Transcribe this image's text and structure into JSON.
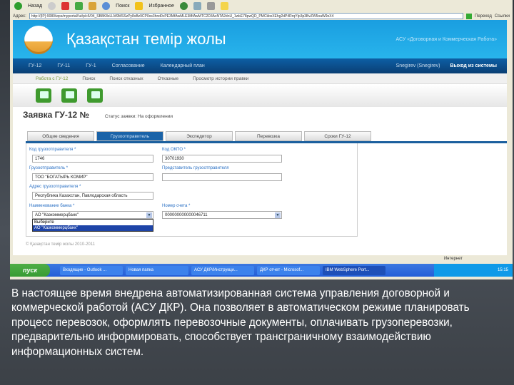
{
  "browser": {
    "back": "Назад",
    "search": "Поиск",
    "favorites": "Избранное",
    "address_label": "Адрес:",
    "url": "http://{IP}:9080/wps/myportal/!ut/p/c5/04_SB8K8xLLM9MSSzPy8xBz9CP0os3hnd0cPE3MfAwMLE3MfAwMTC2D3AxNTA2dnU_1wkE78pwQD_PMCkbxXEhg2dP4RrqYIp3p3BvZW5oaW9oX4",
    "go": "Переход",
    "links": "Ссылки"
  },
  "header": {
    "brand": "Қазақстан темір жолы",
    "subtitle": "АСУ «Договорная и Коммерческая Работа»"
  },
  "nav": {
    "items": [
      "ГУ-12",
      "ГУ-11",
      "ГУ-1",
      "Согласование",
      "Календарный план"
    ],
    "user": "Snegirev (Snegirev)",
    "logout": "Выход из системы"
  },
  "subnav": {
    "items": [
      "Работа с ГУ-12",
      "Поиск",
      "Поиск отказных",
      "Отказные",
      "Просмотр истории правки"
    ]
  },
  "page": {
    "title": "Заявка ГУ-12 №",
    "status": "Статус заявки: На оформлении"
  },
  "tabs": [
    "Общие сведения",
    "Грузоотправитель",
    "Экспедитор",
    "Перевозка",
    "Сроки ГУ-12"
  ],
  "form": {
    "shipper_code_label": "Код грузоотправителя *",
    "shipper_code": "1746",
    "okpo_label": "Код ОКПО *",
    "okpo": "30701930",
    "shipper_label": "Грузоотправитель *",
    "shipper": "ТОО \"БОГАТЫРЬ КОМИР\"",
    "rep_label": "Представитель грузоотправителя",
    "rep": "",
    "address_label": "Адрес грузоотправителя *",
    "address": "Республика Казахстан, Павлодарская область",
    "bank_label": "Наименование банка *",
    "bank": "АО \"Казкоммерцбанк\"",
    "bank_options": [
      "Выберите",
      "АО \"Казкоммерцбанк\""
    ],
    "account_label": "Номер счета *",
    "account": "000000000000046711"
  },
  "footer": "© Қазақстан темір жолы 2010-2011",
  "statusbar": {
    "zone": "Интернет"
  },
  "taskbar": {
    "start": "пуск",
    "items": [
      "Входящие - Outlook ...",
      "Новая папка",
      "АСУ ДКР/Инструкци...",
      "ДКР отчет - Microsof...",
      "IBM WebSphere Port..."
    ],
    "clock": "15:15"
  },
  "caption": "В настоящее время внедрена автоматизированная система управления договорной и коммерческой работой (АСУ ДКР). Она позволяет в автоматическом режиме планировать процесс перевозок, оформлять перевозочные документы, оплачивать грузоперевозки, предварительно информировать, способствует трансграничному взаимодействию информационных систем."
}
